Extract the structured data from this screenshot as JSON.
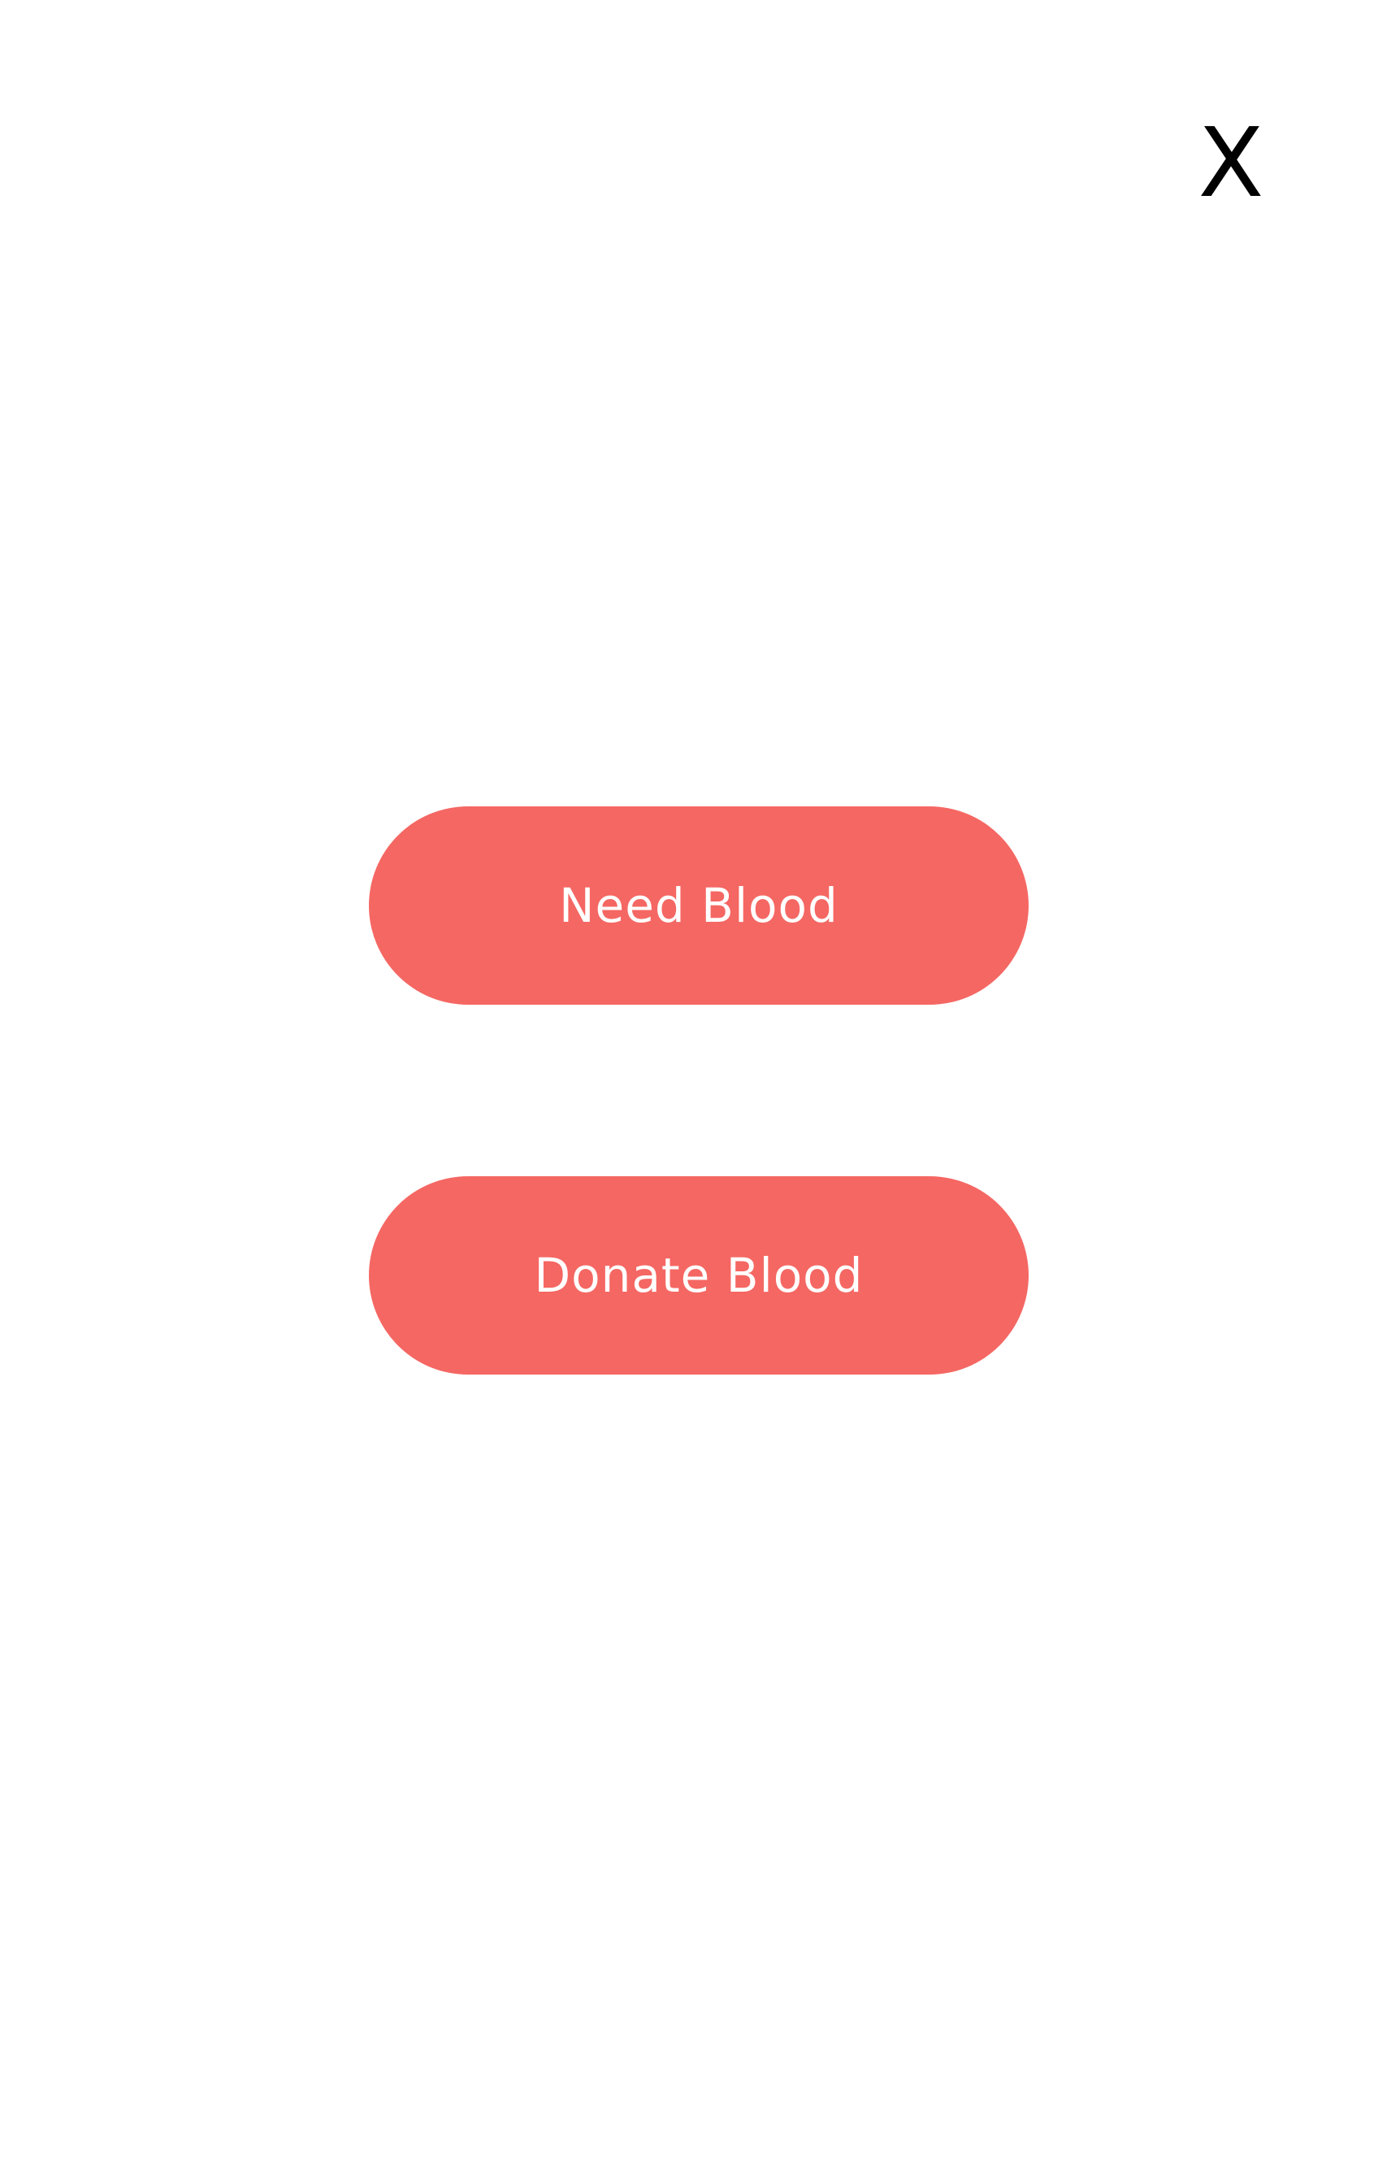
{
  "header": {
    "close_label": "X"
  },
  "actions": {
    "need_blood_label": "Need Blood",
    "donate_blood_label": "Donate Blood"
  },
  "colors": {
    "background": "#FFFFFF",
    "button_accent": "#F56763",
    "button_text": "#FFFFFF",
    "close_text": "#000000"
  }
}
